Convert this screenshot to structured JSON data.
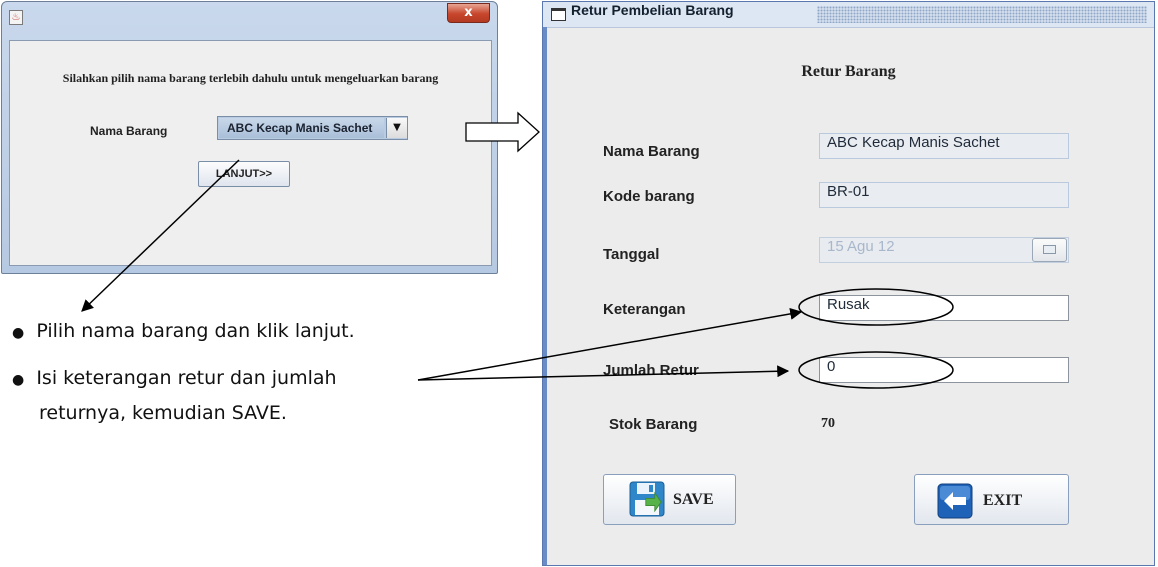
{
  "dialog_pilih": {
    "title_icon": "java-icon",
    "close_label": "x",
    "message": "Silahkan pilih nama barang terlebih dahulu untuk mengeluarkan barang",
    "nama_barang_label": "Nama Barang",
    "nama_barang_value": "ABC Kecap Manis Sachet",
    "dropdown_icon": "▼",
    "lanjut_label": "LANJUT>>"
  },
  "instructions": {
    "bullet1": "Pilih nama barang dan klik lanjut.",
    "bullet2_line1": "Isi keterangan retur dan jumlah",
    "bullet2_line2": "returnya, kemudian SAVE."
  },
  "dialog_retur": {
    "window_title": "Retur Pembelian Barang",
    "heading": "Retur Barang",
    "fields": {
      "nama_barang": {
        "label": "Nama Barang",
        "value": "ABC Kecap Manis Sachet"
      },
      "kode_barang": {
        "label": "Kode barang",
        "value": "BR-01"
      },
      "tanggal": {
        "label": "Tanggal",
        "value": "15 Agu 12"
      },
      "keterangan": {
        "label": "Keterangan",
        "value": "Rusak"
      },
      "jumlah_retur": {
        "label": "Jumlah Retur",
        "value": "0"
      },
      "stok_barang": {
        "label": "Stok Barang",
        "value": "70"
      }
    },
    "save_label": "SAVE",
    "exit_label": "EXIT"
  },
  "colors": {
    "titlebar": "#dde6f3",
    "window_border": "#5a77b0",
    "panel_bg": "#ececec",
    "save_icon_blue": "#2f86c9",
    "save_icon_green": "#58b24a",
    "exit_icon_blue": "#1f63b8"
  }
}
